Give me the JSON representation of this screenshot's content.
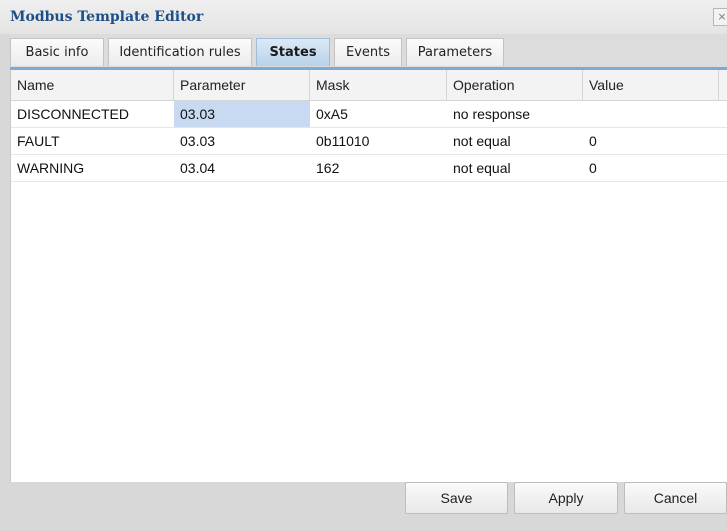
{
  "window": {
    "title": "Modbus Template Editor",
    "close_glyph": "×"
  },
  "tabs": [
    {
      "label": "Basic info",
      "active": false
    },
    {
      "label": "Identification rules",
      "active": false
    },
    {
      "label": "States",
      "active": true
    },
    {
      "label": "Events",
      "active": false
    },
    {
      "label": "Parameters",
      "active": false
    }
  ],
  "table": {
    "columns": [
      "Name",
      "Parameter",
      "Mask",
      "Operation",
      "Value"
    ],
    "rows": [
      {
        "name": "DISCONNECTED",
        "parameter": "03.03",
        "mask": "0xA5",
        "operation": "no response",
        "value": ""
      },
      {
        "name": "FAULT",
        "parameter": "03.03",
        "mask": "0b11010",
        "operation": "not equal",
        "value": "0"
      },
      {
        "name": "WARNING",
        "parameter": "03.04",
        "mask": "162",
        "operation": "not equal",
        "value": "0"
      }
    ],
    "selected_cell": "rows.0.parameter"
  },
  "footer": {
    "save_label": "Save",
    "apply_label": "Apply",
    "cancel_label": "Cancel"
  },
  "colors": {
    "title": "#1d4f86",
    "active_tab": "#b9d2ea",
    "selection": "#c7daf2",
    "tab_underline": "#7ca9d6"
  },
  "icons": {
    "close": "close-icon"
  }
}
